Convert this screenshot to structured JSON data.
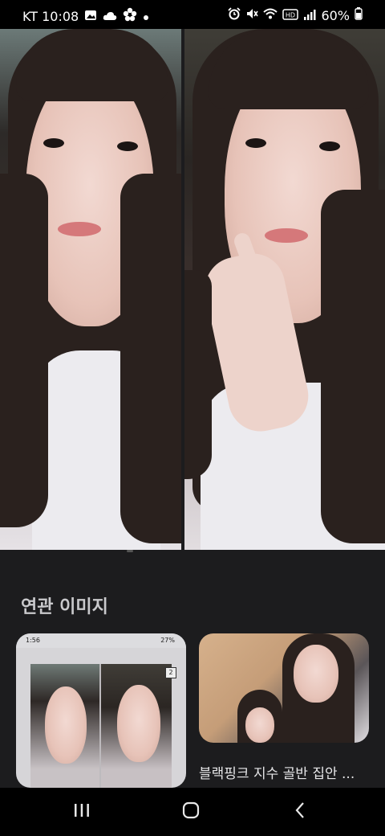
{
  "status_bar": {
    "carrier_time": "KT 10:08",
    "battery": "60%",
    "icons_left": [
      "image-icon",
      "cloud-icon",
      "flower-icon",
      "dot-icon"
    ],
    "icons_right": [
      "alarm-icon",
      "mute-icon",
      "wifi-icon",
      "volte-icon",
      "signal-icon",
      "battery-icon"
    ]
  },
  "section": {
    "title": "연관 이미지"
  },
  "related": [
    {
      "caption": "",
      "mini_status_time": "1:56",
      "mini_battery": "27%",
      "mini_badge": "2"
    },
    {
      "caption": "블랙핑크 지수 골반 집안 ..."
    }
  ],
  "navbar": {
    "icons": [
      "recent-apps-icon",
      "home-icon",
      "back-icon"
    ]
  }
}
